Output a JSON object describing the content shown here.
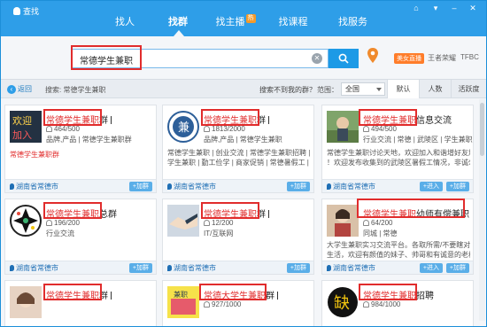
{
  "app": {
    "title": "查找"
  },
  "nav": {
    "tabs": [
      "找人",
      "找群",
      "找主播",
      "找课程",
      "找服务"
    ],
    "hot": "热"
  },
  "search": {
    "value": "常德学生兼职",
    "clear": "✕"
  },
  "side": {
    "beauty": "美女直播",
    "link1": "王者荣耀",
    "link2": "TFBC"
  },
  "filter": {
    "back": "返回",
    "query": "搜索: 常德学生兼职",
    "not_found": "搜索不到我的群？",
    "scope_label": "范围：",
    "scope_value": "全国",
    "sorts": [
      "默认",
      "人数",
      "活跃度"
    ]
  },
  "cards": [
    {
      "hl": "常德学生兼职",
      "rest": "群",
      "members": "464/500",
      "tags": "品牌,产品 | 常德学生兼职群",
      "desc1": "常德学生兼职群",
      "desc2": "",
      "loc": "湖南省常德市",
      "join": "+加群",
      "join2": ""
    },
    {
      "hl": "常德学生兼职",
      "rest": "群",
      "members": "1813/2000",
      "tags": "品牌,产品 | 常德学生兼职",
      "desc1": "常德学生兼职 | 创业交流 | 常德学生兼职招聘 | 常德",
      "desc2": "学生兼职 | 勤工俭学 | 商家促销 | 常德暑假工 |",
      "loc": "湖南省常德市",
      "join": "+加群",
      "join2": ""
    },
    {
      "hl": "常德学生兼职",
      "rest": "信息交流",
      "members": "494/500",
      "tags": "行业交流 | 常德 | 武陵区 | 学生兼职",
      "desc1": "常德学生兼职讨论天地，欢迎加入和谐增好友加入",
      "desc2": "！欢迎发布收集到的武陵区暑假工情况，非诚勿...",
      "loc": "湖南省常德市",
      "join": "+加群",
      "join2": "+进入"
    },
    {
      "hl": "常德学生兼职",
      "rest": "总群",
      "members": "196/200",
      "tags": "行业交流",
      "desc1": "",
      "desc2": "",
      "loc": "湖南省常德市",
      "join": "+加群",
      "join2": ""
    },
    {
      "hl": "常德学生兼职",
      "rest": "群",
      "members": "12/200",
      "tags": "IT/互联网",
      "desc1": "",
      "desc2": "",
      "loc": "湖南省常德市",
      "join": "+加群",
      "join2": ""
    },
    {
      "hl": "常德学生兼职",
      "rest": "幼师有偿兼职",
      "members": "64/200",
      "tags": "同城 | 常德",
      "desc1": "大学生兼职实习交流平台。各取所需/不要瞎对方",
      "desc2": "生活，欢迎有颜值的妹子、帅哥和有诚意的老板...",
      "loc": "湖南省常德市",
      "join": "+加群",
      "join2": "+进入"
    },
    {
      "hl": "常德学生兼职",
      "rest": "群",
      "members": "",
      "tags": "",
      "desc1": "",
      "desc2": "",
      "loc": "",
      "join": "",
      "join2": ""
    },
    {
      "hl": "常德大学生兼职",
      "rest": "群",
      "members": "927/1000",
      "tags": "",
      "desc1": "",
      "desc2": "",
      "loc": "",
      "join": "",
      "join2": ""
    },
    {
      "hl": "常德学生兼职",
      "rest": "招聘",
      "members": "984/1000",
      "tags": "",
      "desc1": "",
      "desc2": "",
      "loc": "",
      "join": "",
      "join2": ""
    }
  ],
  "colors": {
    "accent": "#2e9ee8",
    "highlight": "#e12c2c"
  }
}
